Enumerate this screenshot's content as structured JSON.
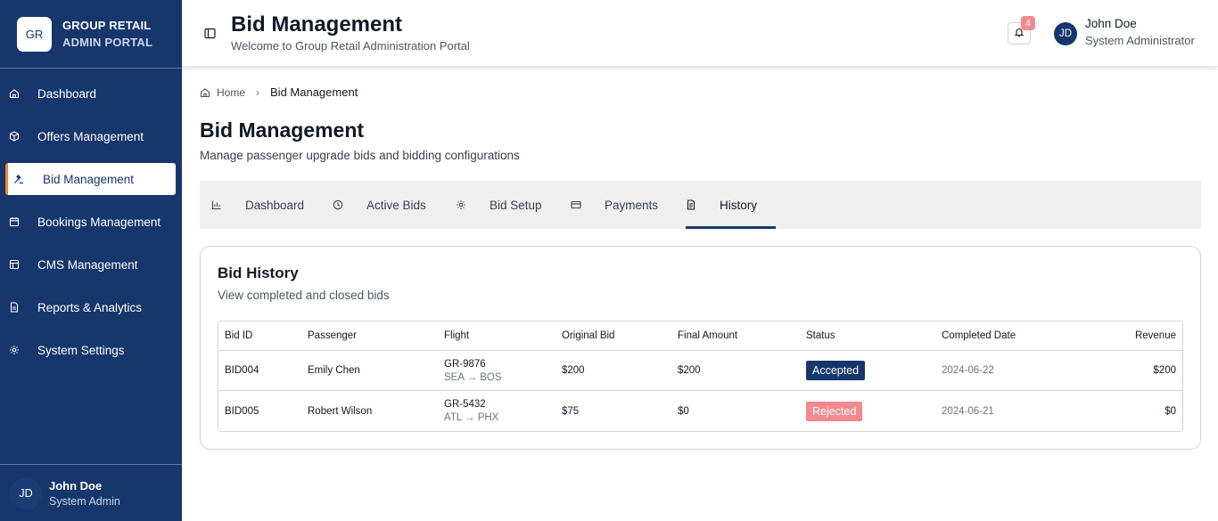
{
  "brand": {
    "logo": "GR",
    "line1": "GROUP RETAIL",
    "line2": "ADMIN PORTAL"
  },
  "sidebar": {
    "items": [
      {
        "label": "Dashboard",
        "icon": "home-icon"
      },
      {
        "label": "Offers Management",
        "icon": "package-icon"
      },
      {
        "label": "Bid Management",
        "icon": "gavel-icon",
        "active": true
      },
      {
        "label": "Bookings Management",
        "icon": "calendar-icon"
      },
      {
        "label": "CMS Management",
        "icon": "layout-icon"
      },
      {
        "label": "Reports & Analytics",
        "icon": "file-icon"
      },
      {
        "label": "System Settings",
        "icon": "gear-icon"
      }
    ],
    "user": {
      "initials": "JD",
      "name": "John Doe",
      "role": "System Admin"
    }
  },
  "header": {
    "title": "Bid Management",
    "subtitle": "Welcome to Group Retail Administration Portal",
    "notifications": "4",
    "user": {
      "initials": "JD",
      "name": "John Doe",
      "role": "System Administrator"
    }
  },
  "breadcrumb": {
    "home": "Home",
    "current": "Bid Management"
  },
  "page": {
    "title": "Bid Management",
    "subtitle": "Manage passenger upgrade bids and bidding configurations"
  },
  "tabs": [
    {
      "label": "Dashboard",
      "icon": "bar-chart-icon"
    },
    {
      "label": "Active Bids",
      "icon": "clock-icon"
    },
    {
      "label": "Bid Setup",
      "icon": "gear-icon"
    },
    {
      "label": "Payments",
      "icon": "credit-card-icon"
    },
    {
      "label": "History",
      "icon": "document-icon",
      "active": true
    }
  ],
  "history": {
    "title": "Bid History",
    "subtitle": "View completed and closed bids",
    "columns": [
      "Bid ID",
      "Passenger",
      "Flight",
      "Original Bid",
      "Final Amount",
      "Status",
      "Completed Date",
      "Revenue"
    ],
    "rows": [
      {
        "bid_id": "BID004",
        "passenger": "Emily Chen",
        "flight": "GR-9876",
        "route": "SEA → BOS",
        "original": "$200",
        "final": "$200",
        "status": "Accepted",
        "date": "2024-06-22",
        "revenue": "$200"
      },
      {
        "bid_id": "BID005",
        "passenger": "Robert Wilson",
        "flight": "GR-5432",
        "route": "ATL → PHX",
        "original": "$75",
        "final": "$0",
        "status": "Rejected",
        "date": "2024-06-21",
        "revenue": "$0"
      }
    ]
  },
  "colors": {
    "sidebar": "#17366b",
    "accent": "#f08a2e",
    "accepted": "#17366b",
    "rejected": "#f08a8f"
  }
}
